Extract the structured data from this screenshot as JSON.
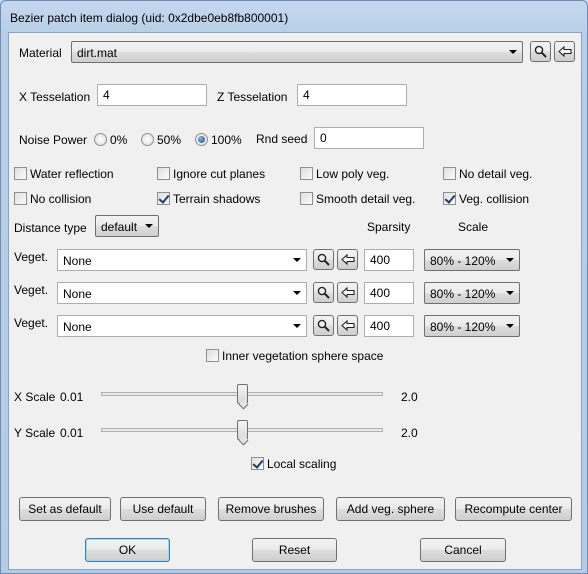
{
  "window": {
    "title": "Bezier patch item dialog (uid: 0x2dbe0eb8fb800001)"
  },
  "material": {
    "label": "Material",
    "value": "dirt.mat"
  },
  "tesselation": {
    "x_label": "X Tesselation",
    "x_value": "4",
    "z_label": "Z Tesselation",
    "z_value": "4"
  },
  "noise": {
    "label": "Noise Power",
    "options": [
      "0%",
      "50%",
      "100%"
    ],
    "selected": "100%",
    "seed_label": "Rnd seed",
    "seed_value": "0"
  },
  "checkboxes": {
    "water_reflection": {
      "label": "Water reflection",
      "checked": false
    },
    "ignore_cut_planes": {
      "label": "Ignore cut planes",
      "checked": false
    },
    "low_poly_veg": {
      "label": "Low poly veg.",
      "checked": false
    },
    "no_detail_veg": {
      "label": "No detail veg.",
      "checked": false
    },
    "no_collision": {
      "label": "No collision",
      "checked": false
    },
    "terrain_shadows": {
      "label": "Terrain shadows",
      "checked": true
    },
    "smooth_detail_veg": {
      "label": "Smooth detail veg.",
      "checked": false
    },
    "veg_collision": {
      "label": "Veg. collision",
      "checked": true
    },
    "inner_veg_sphere": {
      "label": "Inner vegetation sphere space",
      "checked": false
    },
    "local_scaling": {
      "label": "Local scaling",
      "checked": true
    }
  },
  "distance": {
    "label": "Distance type",
    "value": "default"
  },
  "veg_headers": {
    "sparsity": "Sparsity",
    "scale": "Scale"
  },
  "vegetation": [
    {
      "label": "Veget.",
      "value": "None",
      "sparsity": "400",
      "scale": "80% - 120%"
    },
    {
      "label": "Veget.",
      "value": "None",
      "sparsity": "400",
      "scale": "80% - 120%"
    },
    {
      "label": "Veget.",
      "value": "None",
      "sparsity": "400",
      "scale": "80% - 120%"
    }
  ],
  "x_scale": {
    "label": "X Scale",
    "min": "0.01",
    "max": "2.0",
    "level": 0.5
  },
  "y_scale": {
    "label": "Y Scale",
    "min": "0.01",
    "max": "2.0",
    "level": 0.5
  },
  "actions": {
    "set_default": "Set as default",
    "use_default": "Use default",
    "remove_brushes": "Remove brushes",
    "add_veg_sphere": "Add veg. sphere",
    "recompute_center": "Recompute center"
  },
  "footer": {
    "ok": "OK",
    "reset": "Reset",
    "cancel": "Cancel"
  },
  "icons": {
    "browse": "magnifier-icon",
    "assign": "arrow-left-icon"
  }
}
